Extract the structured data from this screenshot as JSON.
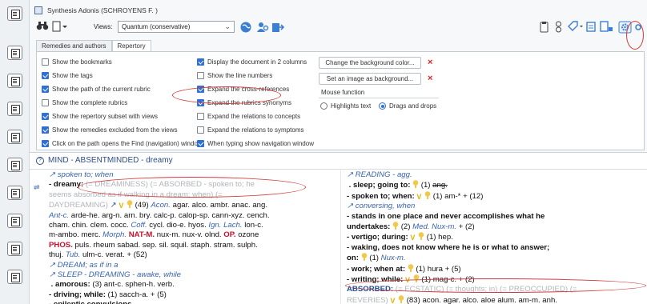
{
  "window": {
    "title": "Synthesis Adonis (SCHROYENS F. )"
  },
  "toolbar": {
    "views_label": "Views:",
    "views_value": "Quantum (conservative)",
    "icons": [
      "binoculars-icon",
      "document-new-icon",
      "globe-icon",
      "person-search-icon",
      "export-icon",
      "clipboard-icon",
      "people-icon",
      "tag-icon",
      "repertory-icon",
      "document-list-icon",
      "settings-gear-icon"
    ]
  },
  "tabs": [
    {
      "label": "Remedies and authors",
      "active": false
    },
    {
      "label": "Repertory",
      "active": true
    }
  ],
  "options_col1": [
    {
      "label": "Show the bookmarks",
      "checked": false
    },
    {
      "label": "Show the tags",
      "checked": true
    },
    {
      "label": "Show the path of the current rubric",
      "checked": true
    },
    {
      "label": "Show the complete rubrics",
      "checked": false
    },
    {
      "label": "Show the repertory subset with views",
      "checked": true
    },
    {
      "label": "Show the remedies excluded from the views",
      "checked": true
    },
    {
      "label": "Click on the path opens the Find (navigation) window",
      "checked": true
    }
  ],
  "options_col2": [
    {
      "label": "Display the document in 2 columns",
      "checked": true
    },
    {
      "label": "Show the line numbers",
      "checked": false
    },
    {
      "label": "Expand the cross-references",
      "checked": true
    },
    {
      "label": "Expand the rubrics synonyms",
      "checked": true
    },
    {
      "label": "Expand the relations to concepts",
      "checked": false
    },
    {
      "label": "Expand the relations to symptoms",
      "checked": false
    },
    {
      "label": "When typing show navigation window",
      "checked": true
    }
  ],
  "background": {
    "change_color": "Change the background color...",
    "set_image": "Set an image as background..."
  },
  "mouse": {
    "title": "Mouse function",
    "highlights": "Highlights text",
    "drags": "Drags and drops",
    "selected": "drags"
  },
  "chapter": {
    "title": "MIND - ABSENTMINDED - dreamy"
  },
  "colors": {
    "accent_blue": "#2f6fd6",
    "link_blue": "#3864b0",
    "red_remedy": "#c8102e",
    "oval_red": "#d23a3a"
  }
}
